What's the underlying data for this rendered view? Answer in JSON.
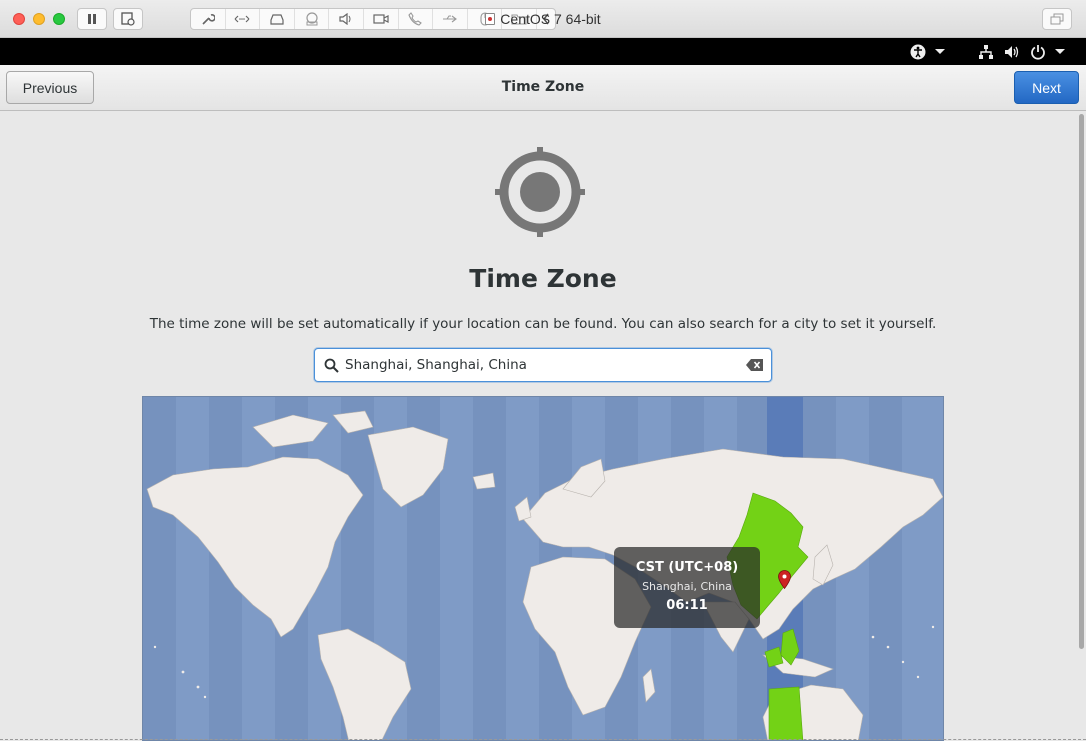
{
  "window": {
    "title": "CentOS 7 64-bit"
  },
  "header": {
    "title": "Time Zone",
    "previous_label": "Previous",
    "next_label": "Next"
  },
  "page": {
    "heading": "Time Zone",
    "description": "The time zone will be set automatically if your location can be found. You can also search for a city to set it yourself."
  },
  "search": {
    "value": "Shanghai, Shanghai, China"
  },
  "tooltip": {
    "timezone": "CST (UTC+08)",
    "location": "Shanghai, China",
    "time": "06:11"
  },
  "colors": {
    "ocean": "#7f9bc6",
    "land": "#efebe8",
    "selected_zone_land": "#73d216",
    "selected_zone_band": "#5a7cb8",
    "accent": "#4a90d9",
    "pin": "#cc2222"
  }
}
